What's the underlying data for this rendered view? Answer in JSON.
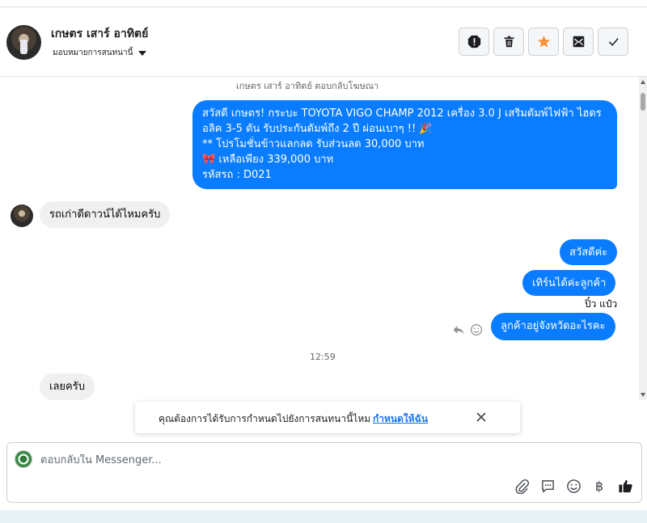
{
  "header": {
    "contact_name": "เกษตร เสาร์ อาทิตย์",
    "assign_label": "มอบหมายการสนทนานี้",
    "actions": [
      "spam-icon",
      "trash-icon",
      "star-icon",
      "mark-unread-icon",
      "check-icon"
    ],
    "star_color": "#f7923b"
  },
  "chat": {
    "reply_note": "เกษตร เสาร์ อาทิตย์ ตอบกลับโฆษณา",
    "ad_message": {
      "line1": "สวัสดี เกษตร! กระบะ TOYOTA VIGO CHAMP 2012 เครื่อง 3.0 J เสริมดัมพ์ไฟฟ้า ไฮดร",
      "line2": "อลิค 3-5 ตัน รับประกันดัมพ์ถึง 2 ปี ผ่อนเบาๆ !! 🎉",
      "line3": "** โปรโมชั่นข้าวแลกลด รับส่วนลด 30,000 บาท",
      "line4": "🎀 เหลือเพียง 339,000 บาท",
      "line5": " รหัสรถ : D021"
    },
    "incoming_1": "รถเก่าดีดาวน์ได้ไหมครับ",
    "outgoing_1": "สวัสดีค่ะ",
    "outgoing_2": "เทิร์นได้ค่ะลูกค้า",
    "sender_name": "ปิ๋ว แป๋ว",
    "outgoing_3": "ลูกค้าอยู่จังหวัดอะไรคะ",
    "timestamp": "12:59",
    "incoming_2": "เลยครับ",
    "outgoing_color": "#0a7cff"
  },
  "toast": {
    "text": "คุณต้องการได้รับการกำหนดไปยังการสนทนานี้ไหม",
    "link": "กำหนดให้ฉัน"
  },
  "composer": {
    "placeholder": "ตอบกลับใน Messenger...",
    "tools": [
      "attachment-icon",
      "saved-replies-icon",
      "emoji-icon",
      "payment-icon",
      "like-icon"
    ],
    "payment_glyph": "฿"
  }
}
